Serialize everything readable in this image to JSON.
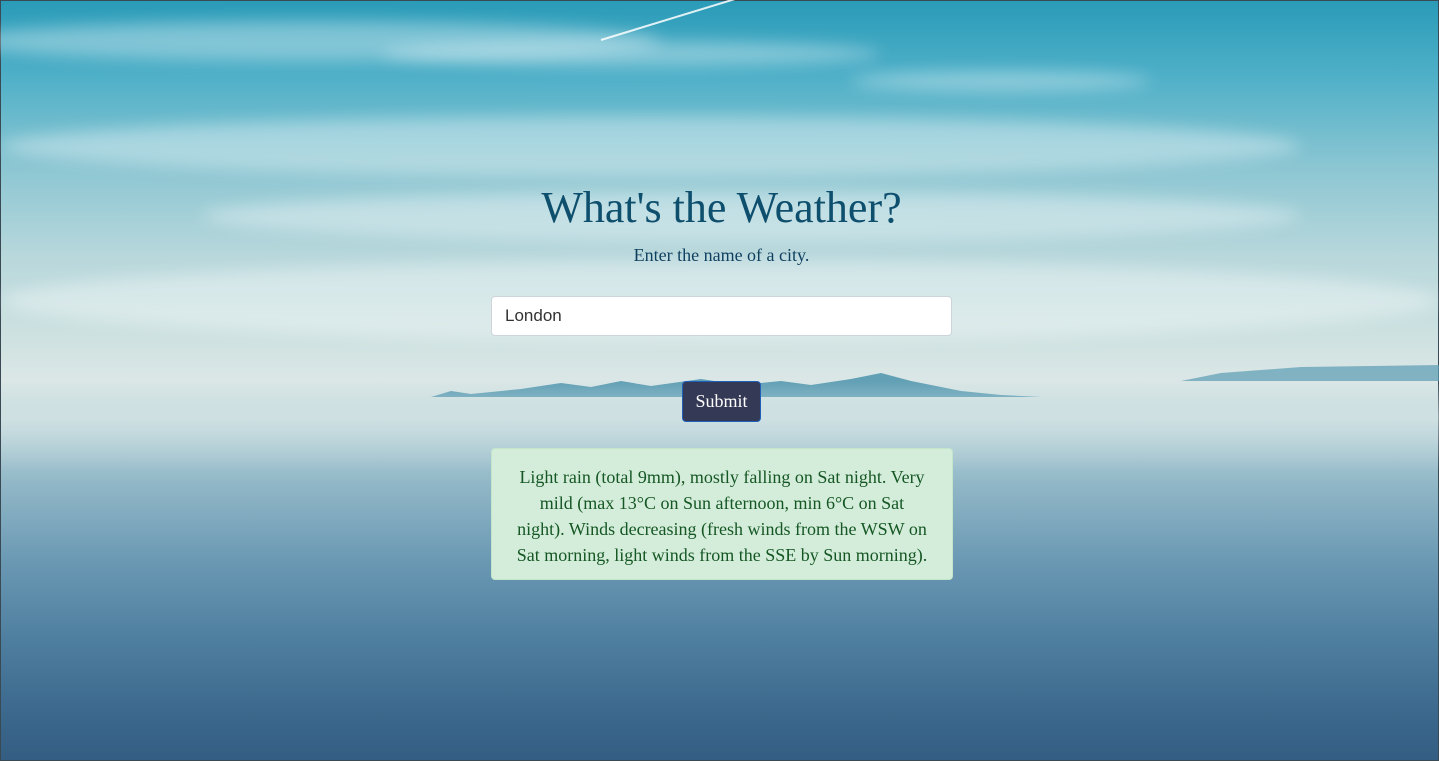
{
  "page": {
    "title": "What's the Weather?",
    "subtitle": "Enter the name of a city."
  },
  "form": {
    "city_value": "London",
    "submit_label": "Submit"
  },
  "result": {
    "text": "Light rain (total 9mm), mostly falling on Sat night. Very mild (max 13°C on Sun afternoon, min 6°C on Sat night). Winds decreasing (fresh winds from the WSW on Sat morning, light winds from the SSE by Sun morning)."
  },
  "colors": {
    "title": "#0e4f6e",
    "button_bg": "#343a55",
    "result_bg": "#d4edda",
    "result_text": "#155724"
  }
}
